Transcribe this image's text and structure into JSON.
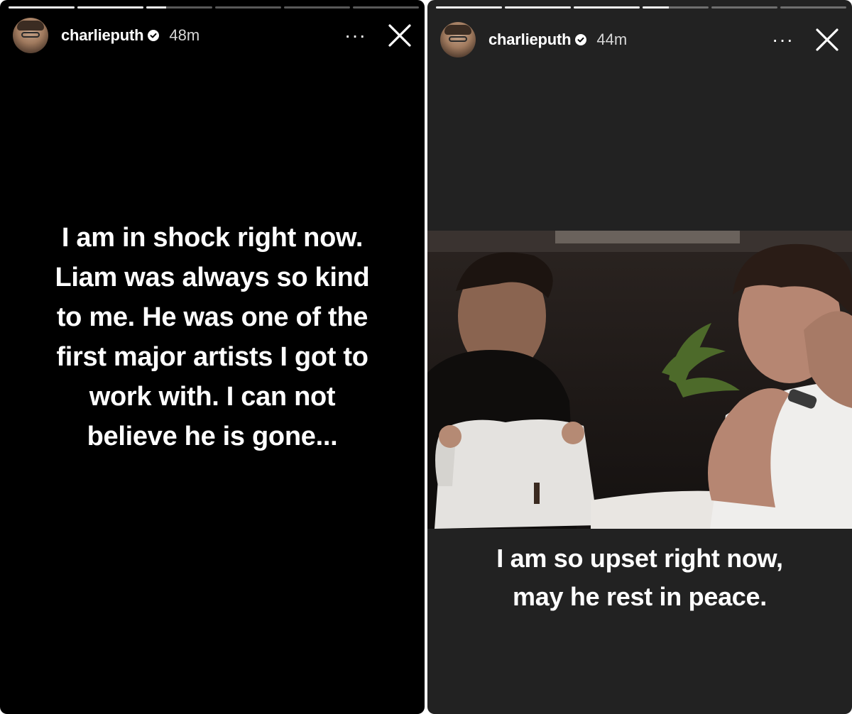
{
  "stories": [
    {
      "username": "charlieputh",
      "timestamp": "48m",
      "more_label": "···",
      "caption_lines": [
        "I am in shock right now.",
        "Liam was always so kind",
        "to me. He was one of the",
        "first major artists I got to",
        "work with. I can not",
        "believe he is gone..."
      ],
      "progress_segments": [
        1,
        1,
        0.3,
        0,
        0,
        0
      ]
    },
    {
      "username": "charlieputh",
      "timestamp": "44m",
      "more_label": "···",
      "caption_lines": [
        "I am so upset right now,",
        "may he rest in peace."
      ],
      "progress_segments": [
        1,
        1,
        1,
        0.4,
        0,
        0
      ]
    }
  ],
  "icons": {
    "avatar": "profile-photo",
    "verified": "verified-badge-icon",
    "more": "more-options-icon",
    "close": "close-icon"
  },
  "colors": {
    "left_background": "#000000",
    "right_background": "#222222",
    "text": "#ffffff",
    "timestamp": "#d8d8d8"
  }
}
